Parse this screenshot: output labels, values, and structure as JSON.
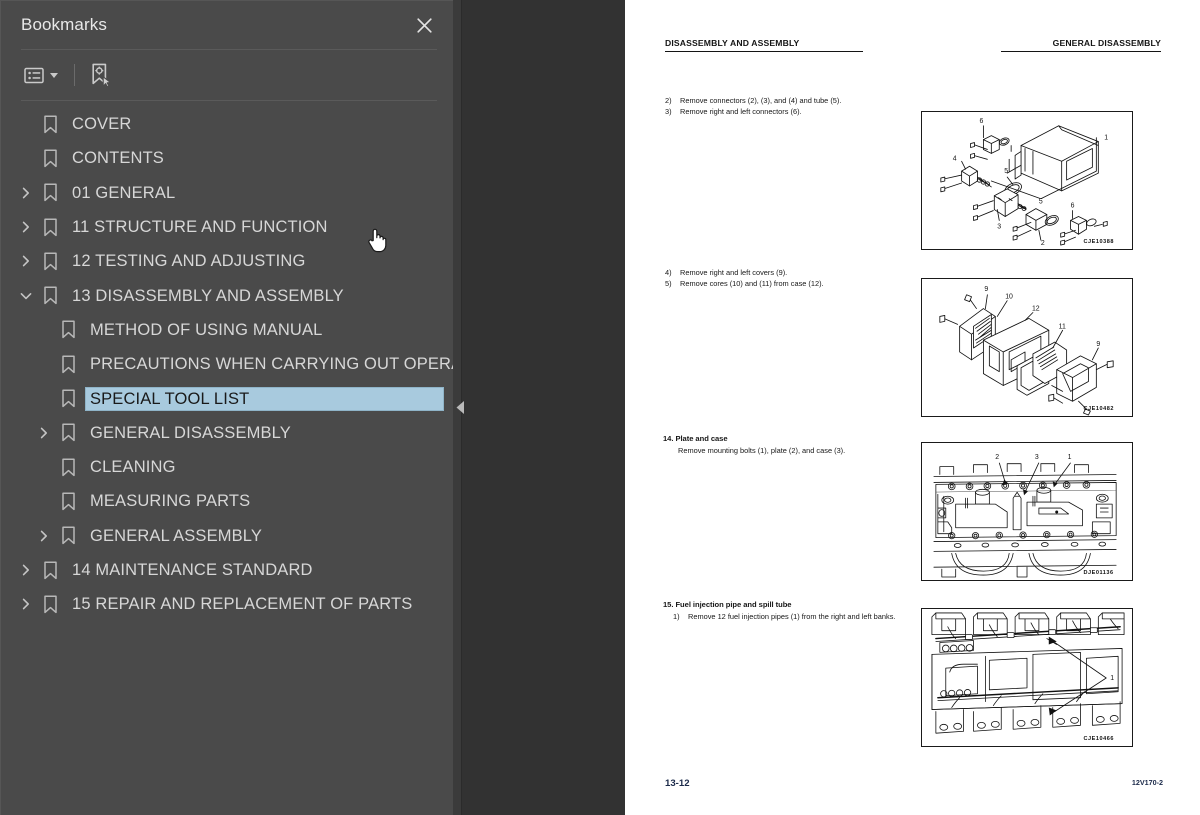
{
  "sidebar": {
    "title": "Bookmarks",
    "close_icon": "close-icon",
    "toolbar": {
      "options_icon": "list-options-icon",
      "options_caret": "chevron-down-icon",
      "new_bookmark_icon": "new-bookmark-icon"
    },
    "collapse_icon": "collapse-left-icon",
    "items": [
      {
        "label": "COVER",
        "level": 0,
        "twisty": "none",
        "selected": false
      },
      {
        "label": "CONTENTS",
        "level": 0,
        "twisty": "none",
        "selected": false
      },
      {
        "label": "01 GENERAL",
        "level": 0,
        "twisty": "collapsed",
        "selected": false
      },
      {
        "label": "11 STRUCTURE AND FUNCTION",
        "level": 0,
        "twisty": "collapsed",
        "selected": false
      },
      {
        "label": "12 TESTING AND ADJUSTING",
        "level": 0,
        "twisty": "collapsed",
        "selected": false
      },
      {
        "label": "13 DISASSEMBLY AND ASSEMBLY",
        "level": 0,
        "twisty": "expanded",
        "selected": false
      },
      {
        "label": "METHOD OF USING MANUAL",
        "level": 1,
        "twisty": "none",
        "selected": false
      },
      {
        "label": "PRECAUTIONS WHEN CARRYING OUT OPERATION",
        "level": 1,
        "twisty": "none",
        "selected": false
      },
      {
        "label": "SPECIAL TOOL LIST",
        "level": 1,
        "twisty": "none",
        "selected": true
      },
      {
        "label": "GENERAL DISASSEMBLY",
        "level": 1,
        "twisty": "collapsed",
        "selected": false
      },
      {
        "label": "CLEANING",
        "level": 1,
        "twisty": "none",
        "selected": false
      },
      {
        "label": "MEASURING PARTS",
        "level": 1,
        "twisty": "none",
        "selected": false
      },
      {
        "label": "GENERAL ASSEMBLY",
        "level": 1,
        "twisty": "collapsed",
        "selected": false
      },
      {
        "label": "14 MAINTENANCE STANDARD",
        "level": 0,
        "twisty": "collapsed",
        "selected": false
      },
      {
        "label": "15 REPAIR  AND REPLACEMENT OF PARTS",
        "level": 0,
        "twisty": "collapsed",
        "selected": false
      }
    ]
  },
  "page": {
    "header_left": "DISASSEMBLY AND ASSEMBLY",
    "header_right": "GENERAL DISASSEMBLY",
    "footer_left": "13-12",
    "footer_right": "12V170-2",
    "blocks": [
      {
        "title": "",
        "steps": [
          {
            "n": "2)",
            "text": "Remove  connectors  (2),  (3),  and  (4)  and tube (5)."
          },
          {
            "n": "3)",
            "text": "Remove right and left connectors (6)."
          }
        ],
        "figure_code": "CJE10388"
      },
      {
        "title": "",
        "steps": [
          {
            "n": "4)",
            "text": "Remove right and left covers (9)."
          },
          {
            "n": "5)",
            "text": "Remove cores (10) and (11) from case (12)."
          }
        ],
        "figure_code": "CJE10482"
      },
      {
        "title": "14. Plate and case",
        "steps": [
          {
            "n": "",
            "text": "Remove mounting bolts (1), plate (2), and case (3)."
          }
        ],
        "figure_code": "DJE01136"
      },
      {
        "title": "15. Fuel injection pipe and spill tube",
        "steps": [
          {
            "n": "1)",
            "text": "Remove 12 fuel injection pipes (1) from the right and left banks."
          }
        ],
        "figure_code": "CJE10466"
      }
    ],
    "figure_callouts": {
      "fig1": [
        "6",
        "1",
        "4",
        "5",
        "5",
        "6",
        "3",
        "2"
      ],
      "fig2": [
        "9",
        "10",
        "12",
        "11",
        "9"
      ],
      "fig3": [
        "2",
        "3",
        "1"
      ],
      "fig4": [
        "1"
      ]
    }
  },
  "colors": {
    "panel_bg": "#4a4a4a",
    "viewer_bg": "#3b3b3b",
    "selection": "#a8cade",
    "text": "#d7d7d7",
    "page_bg": "#ffffff"
  },
  "cursor": {
    "icon": "pointing-hand-cursor"
  }
}
